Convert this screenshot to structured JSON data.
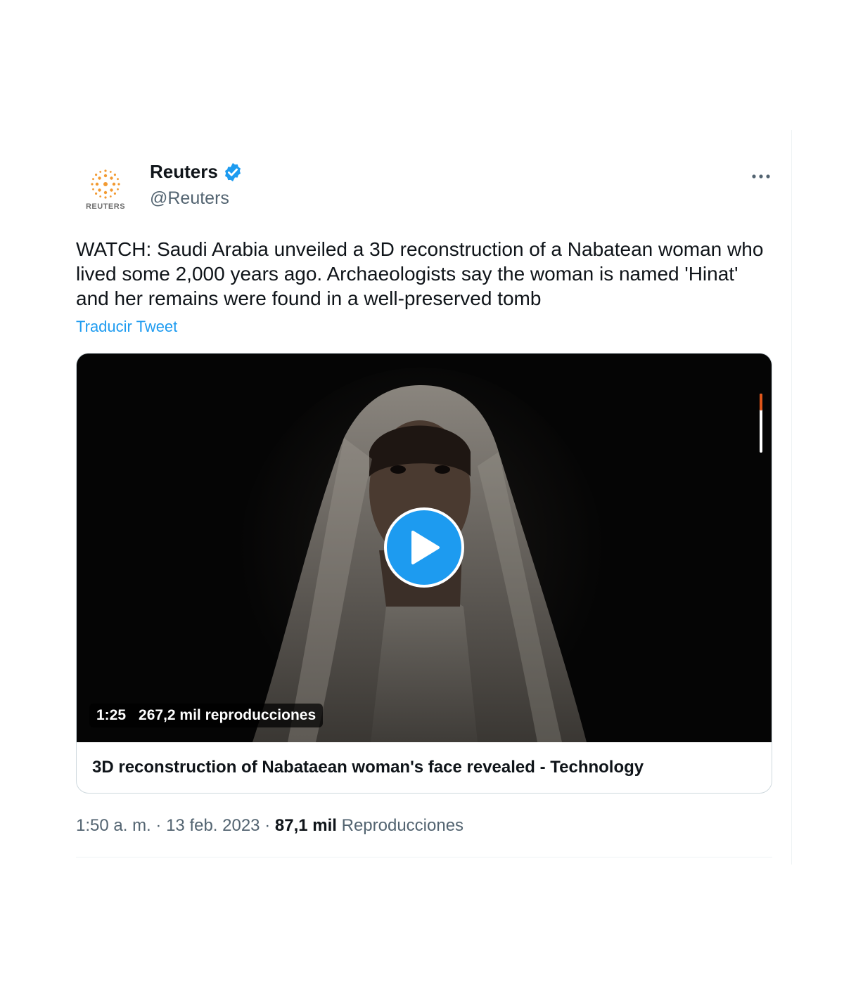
{
  "tweet": {
    "author": {
      "name": "Reuters",
      "handle": "@Reuters",
      "verified": true,
      "avatar_text": "REUTERS"
    },
    "more_icon": "more-horizontal-icon",
    "text": "WATCH: Saudi Arabia unveiled a 3D reconstruction of a Nabatean woman who lived some 2,000 years ago. Archaeologists say the woman is named 'Hinat' and her remains were found in a well-preserved tomb",
    "translate_label": "Traducir Tweet",
    "media": {
      "duration": "1:25",
      "views": "267,2 mil reproducciones",
      "play_icon": "play-icon",
      "title": "3D reconstruction of Nabataean woman's face revealed - Technology"
    },
    "timestamp": {
      "time": "1:50 a. m.",
      "sep1": "·",
      "date": "13 feb. 2023",
      "sep2": "·",
      "views_count": "87,1 mil",
      "views_label": "Reproducciones"
    }
  },
  "colors": {
    "accent": "#1d9bf0",
    "text": "#0f1419",
    "secondary": "#536471",
    "border": "#cfd9de"
  }
}
